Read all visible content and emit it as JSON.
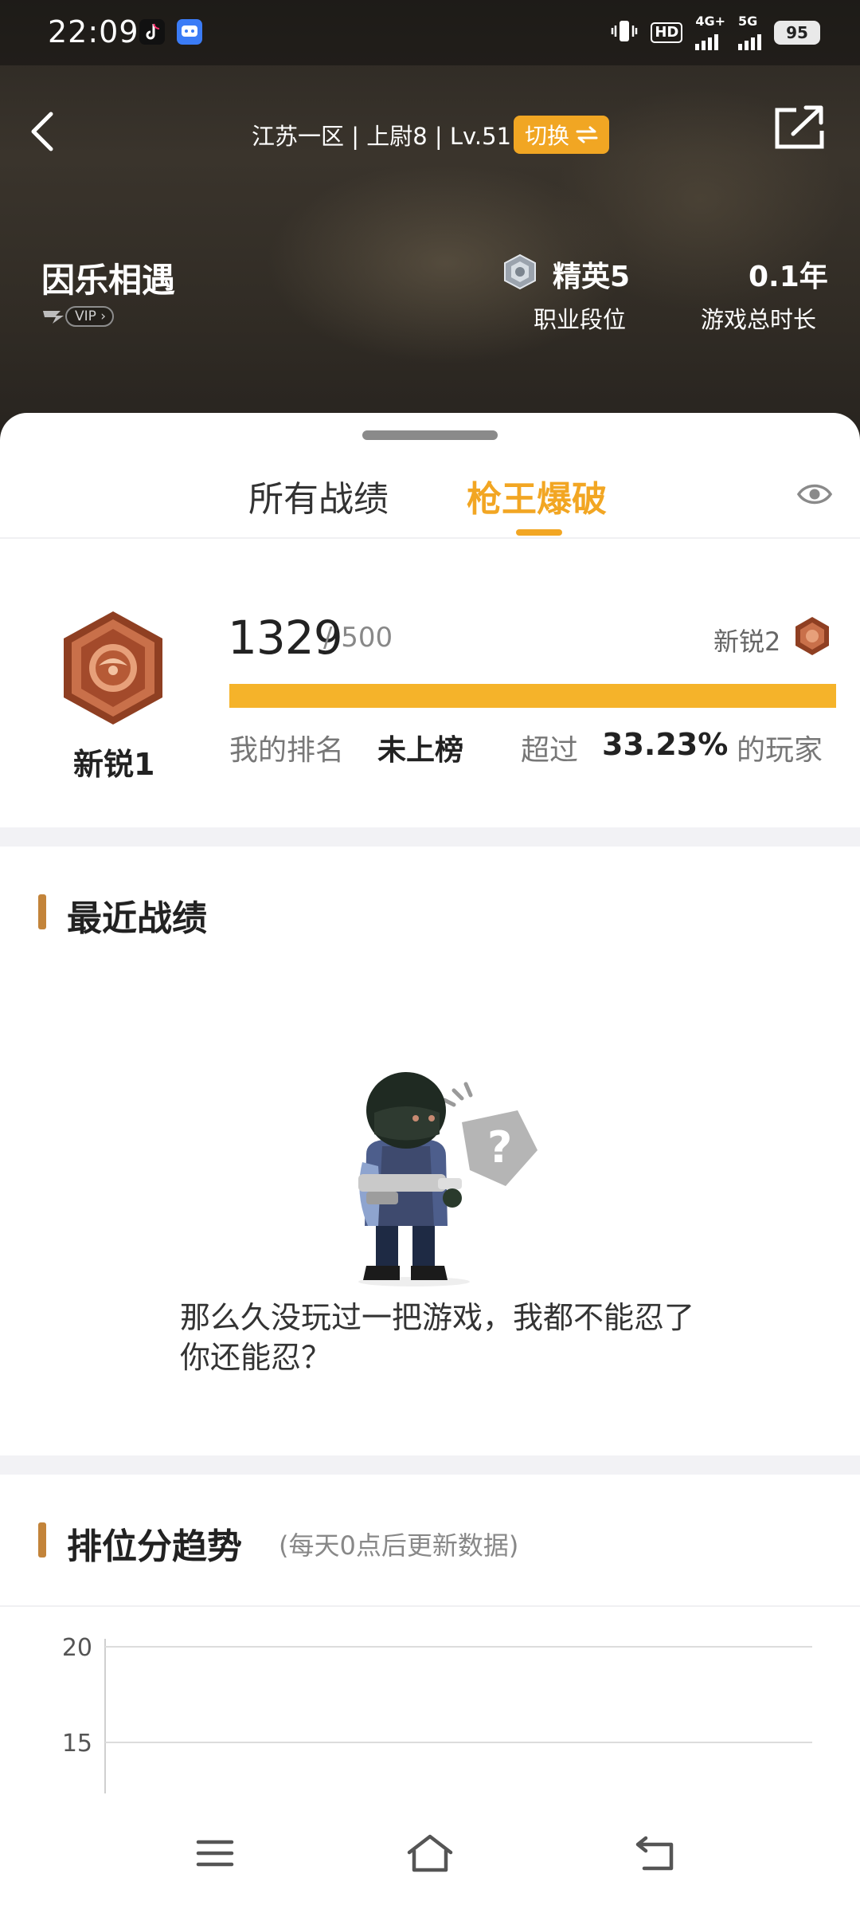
{
  "status_bar": {
    "time": "22:09",
    "hd_label": "HD",
    "network_4g": "4G+",
    "network_5g": "5G",
    "battery": "95"
  },
  "header": {
    "server_info": "江苏一区 | 上尉8 | Lv.51",
    "switch_label": "切换",
    "nickname": "因乐相遇",
    "vip_label": "VIP",
    "career_rank_value": "精英5",
    "career_rank_label": "职业段位",
    "play_time_value": "0.1年",
    "play_time_label": "游戏总时长"
  },
  "tabs": {
    "all_records": "所有战绩",
    "gunking": "枪王爆破",
    "active": "枪王爆破"
  },
  "rank_card": {
    "current_rank": "新锐1",
    "score": "1329",
    "score_max": "/ 500",
    "next_rank": "新锐2",
    "progress": 1.0,
    "my_rank_label": "我的排名",
    "my_rank_value": "未上榜",
    "exceed_label": "超过",
    "exceed_value": "33.23%",
    "exceed_suffix": "的玩家"
  },
  "recent": {
    "title": "最近战绩",
    "empty_message": "那么久没玩过一把游戏，我都不能忍了你还能忍？"
  },
  "trend": {
    "title": "排位分趋势",
    "subtitle": "(每天0点后更新数据)"
  },
  "chart_data": {
    "type": "line",
    "title": "排位分趋势",
    "xlabel": "",
    "ylabel": "",
    "y_ticks": [
      20,
      15
    ],
    "ylim": [
      12,
      22
    ],
    "grid": true,
    "series": []
  },
  "colors": {
    "accent": "#f2a623",
    "progress": "#f5b32a",
    "section_bar": "#c3843a"
  }
}
